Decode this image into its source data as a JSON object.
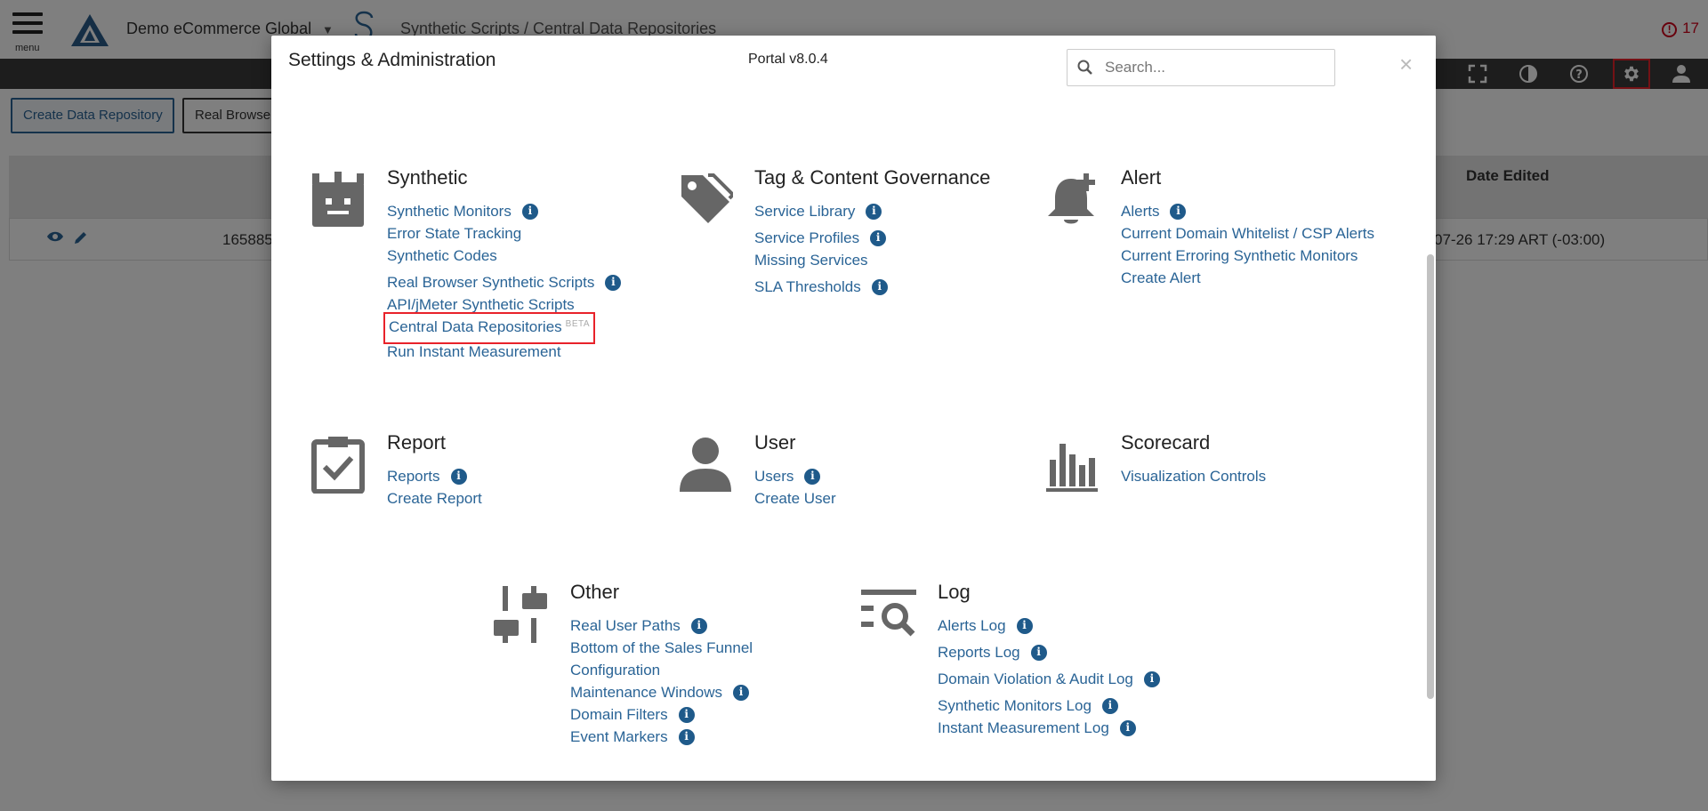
{
  "app": {
    "menu_label": "menu",
    "account": "Demo eCommerce Global",
    "breadcrumb": "Synthetic Scripts / Central Data Repositories",
    "alert_count": "17"
  },
  "toolbar": {
    "icons": [
      "fullscreen-icon",
      "contrast-icon",
      "help-icon",
      "gear-icon",
      "user-icon"
    ]
  },
  "buttons": {
    "create_repo": "Create Data Repository",
    "real_browser": "Real Browser"
  },
  "table": {
    "col_date_edited": "Date Edited",
    "row_id": "165885",
    "row_date": "07-26 17:29 ART (-03:00)"
  },
  "modal": {
    "title": "Settings & Administration",
    "version": "Portal v8.0.4",
    "search_placeholder": "Search...",
    "close": "×",
    "sections": {
      "synthetic": {
        "title": "Synthetic",
        "items": [
          "Synthetic Monitors",
          "Error State Tracking",
          "Synthetic Codes",
          "Real Browser Synthetic Scripts",
          "API/jMeter Synthetic Scripts",
          "Central Data Repositories",
          "Run Instant Measurement"
        ],
        "beta": "BETA"
      },
      "tag": {
        "title": "Tag & Content Governance",
        "items": [
          "Service Library",
          "Service Profiles",
          "Missing Services",
          "SLA Thresholds"
        ]
      },
      "alert": {
        "title": "Alert",
        "items": [
          "Alerts",
          "Current Domain Whitelist / CSP Alerts",
          "Current Erroring Synthetic Monitors",
          "Create Alert"
        ]
      },
      "report": {
        "title": "Report",
        "items": [
          "Reports",
          "Create Report"
        ]
      },
      "user": {
        "title": "User",
        "items": [
          "Users",
          "Create User"
        ]
      },
      "scorecard": {
        "title": "Scorecard",
        "items": [
          "Visualization Controls"
        ]
      },
      "other": {
        "title": "Other",
        "items": [
          "Real User Paths",
          "Bottom of the Sales Funnel Configuration",
          "Maintenance Windows",
          "Domain Filters",
          "Event Markers"
        ]
      },
      "log": {
        "title": "Log",
        "items": [
          "Alerts Log",
          "Reports Log",
          "Domain Violation & Audit Log",
          "Synthetic Monitors Log",
          "Instant Measurement Log"
        ]
      }
    }
  },
  "colors": {
    "link": "#2a6496",
    "info_badge": "#1f5a8a",
    "highlight": "#e8222a",
    "toolbar": "#3a3a3a"
  }
}
